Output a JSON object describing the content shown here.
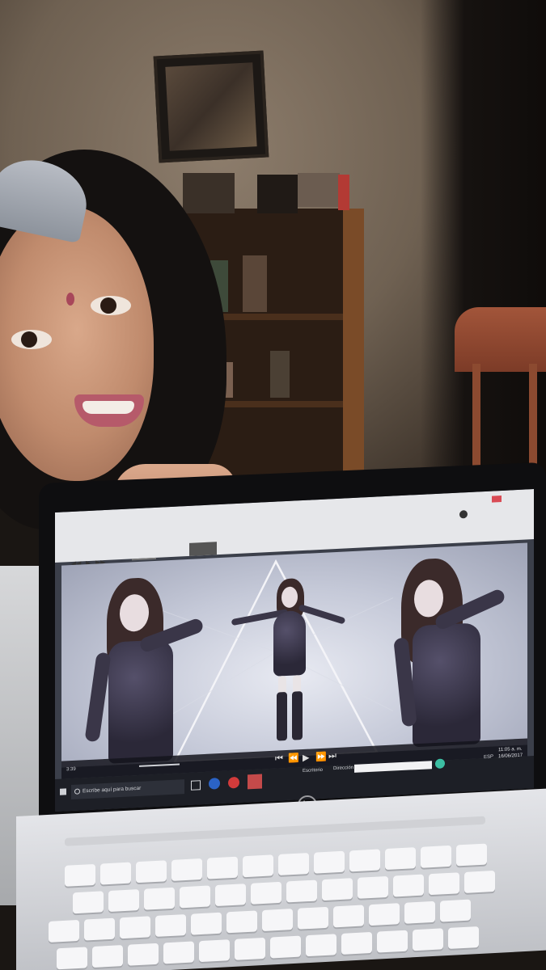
{
  "laptop": {
    "brand_logo": "hp",
    "screen": {
      "taskbar": {
        "search_placeholder": "Escribe aquí para buscar",
        "left_time": "3:39",
        "label_escritorio": "Escritorio",
        "label_direccion": "Dirección",
        "clock_time": "11:05 a. m.",
        "clock_date": "16/06/2017",
        "lang": "ESP"
      }
    }
  },
  "colors": {
    "wall": "#7a6a59",
    "shelf_wood": "#7a4b28",
    "chair": "#9b4d33",
    "laptop_body": "#0e0e10",
    "keyboard": "#e4e5e9"
  },
  "icons": [
    "play-icon",
    "previous-icon",
    "next-icon",
    "search-icon",
    "hp-logo-icon"
  ]
}
